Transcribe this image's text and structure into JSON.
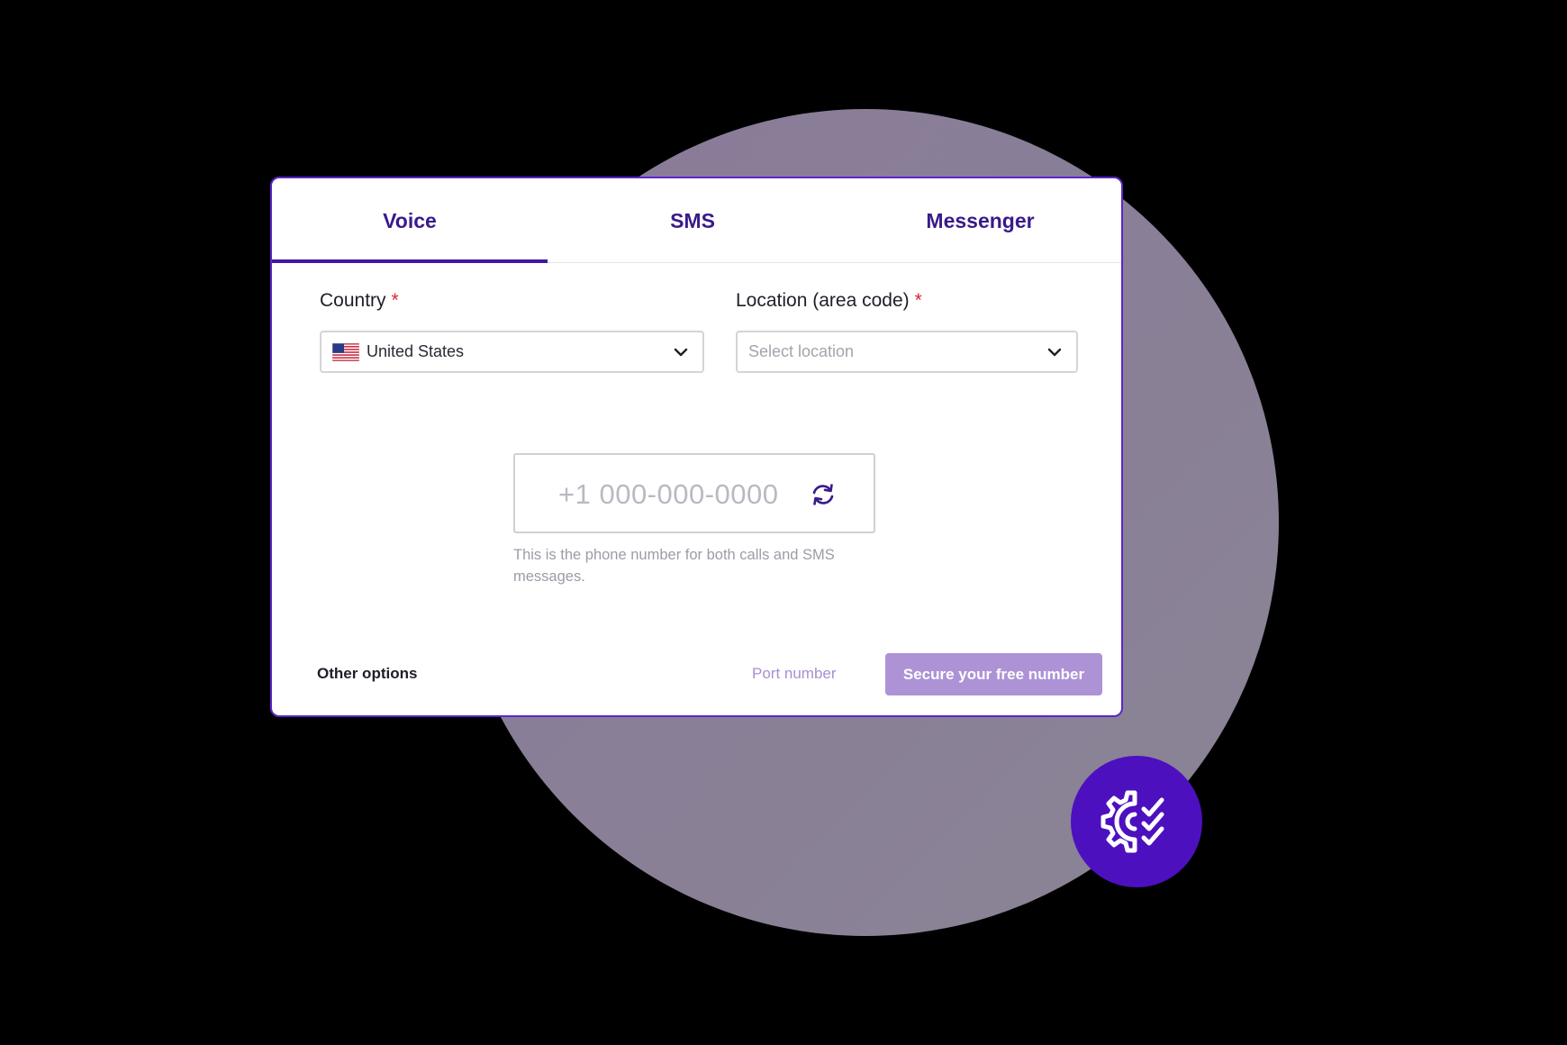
{
  "tabs": [
    {
      "label": "Voice",
      "active": true
    },
    {
      "label": "SMS",
      "active": false
    },
    {
      "label": "Messenger",
      "active": false
    }
  ],
  "form": {
    "country": {
      "label": "Country",
      "required_mark": "*",
      "value": "United States",
      "flag_icon": "us-flag-icon"
    },
    "location": {
      "label": "Location (area code)",
      "required_mark": "*",
      "placeholder": "Select location"
    },
    "phone": {
      "number": "+1 000-000-0000",
      "helper": "This is the phone number for both calls and SMS messages."
    }
  },
  "footer": {
    "other_options": "Other options",
    "port_number": "Port number",
    "secure_button": "Secure your free number"
  },
  "colors": {
    "accent": "#3f1ba0",
    "tab_text": "#3a1a8a",
    "button_bg": "#ad93d6",
    "badge_bg": "#4d10bf",
    "required": "#d9252f",
    "bg_circle": "#8a7f97"
  },
  "badge": {
    "icon": "gear-checklist-icon"
  }
}
